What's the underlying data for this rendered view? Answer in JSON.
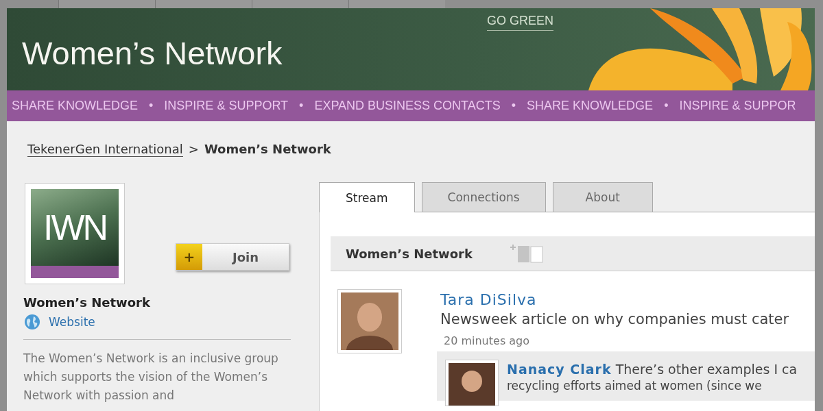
{
  "banner": {
    "title": "Women’s Network",
    "tagline": "GO GREEN"
  },
  "strip": {
    "separator": "•",
    "items": [
      "SHARE KNOWLEDGE",
      "INSPIRE & SUPPORT",
      "EXPAND BUSINESS CONTACTS",
      "SHARE KNOWLEDGE",
      "INSPIRE & SUPPOR"
    ]
  },
  "breadcrumb": {
    "parent": "TekenerGen International",
    "separator": ">",
    "current": "Women’s Network"
  },
  "group": {
    "logo_text": "IWN",
    "join_icon": "+",
    "join_label": "Join",
    "name": "Women’s Network",
    "website": "Website",
    "description": "The Women’s Network is an inclusive group which supports the vision of the Women’s Network with passion and"
  },
  "tabs": [
    {
      "label": "Stream",
      "selected": true
    },
    {
      "label": "Connections",
      "selected": false
    },
    {
      "label": "About",
      "selected": false
    }
  ],
  "stream": {
    "title": "Women’s Network",
    "post": {
      "author": "Tara DiSilva",
      "text": "Newsweek article on why companies must cater",
      "time": "20 minutes ago",
      "comment": {
        "author": "Nanacy Clark",
        "text": "There’s other examples I ca",
        "text_2": "recycling efforts aimed at women (since we"
      }
    }
  }
}
